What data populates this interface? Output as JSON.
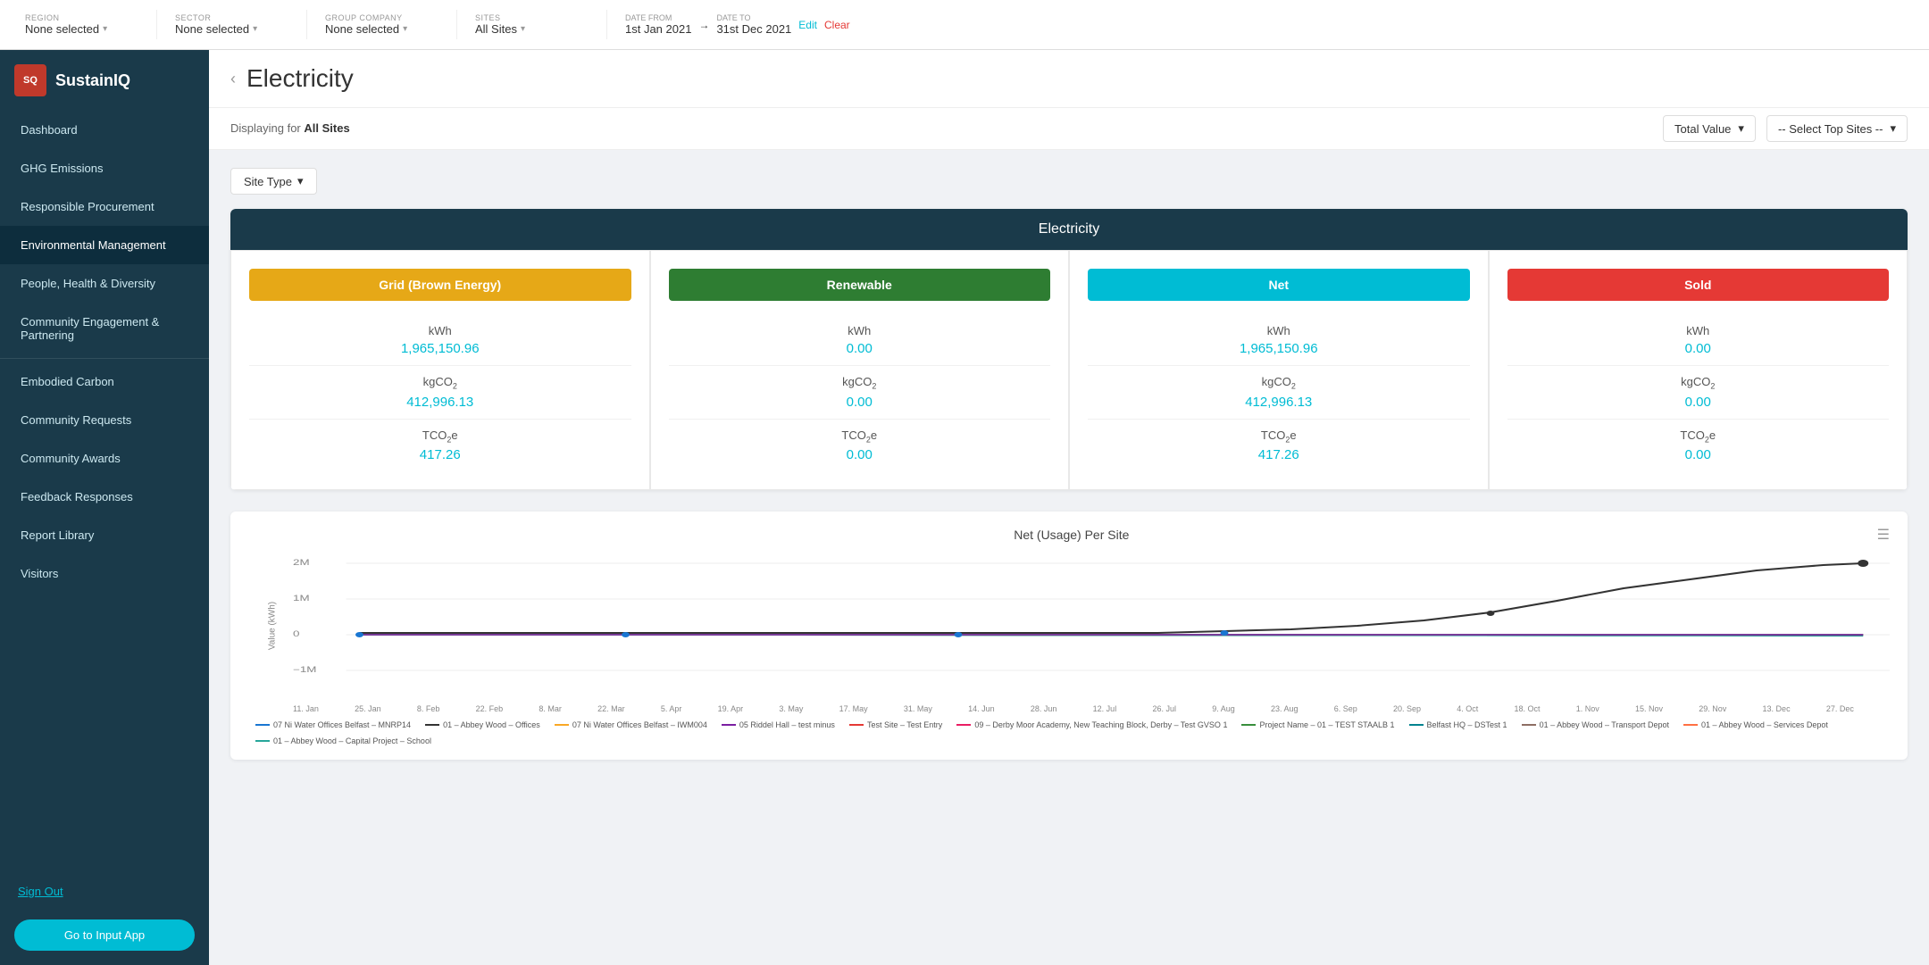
{
  "topbar": {
    "region_label": "REGION",
    "region_value": "None selected",
    "sector_label": "SECTOR",
    "sector_value": "None selected",
    "group_company_label": "GROUP COMPANY",
    "group_company_value": "None selected",
    "sites_label": "SITES",
    "sites_value": "All Sites",
    "date_from_label": "DATE FROM",
    "date_from_value": "1st Jan 2021",
    "date_to_label": "DATE TO",
    "date_to_value": "31st Dec 2021",
    "edit_label": "Edit",
    "clear_label": "Clear"
  },
  "sidebar": {
    "logo_text": "SQ",
    "app_name": "SustainIQ",
    "items": [
      {
        "id": "dashboard",
        "label": "Dashboard"
      },
      {
        "id": "ghg",
        "label": "GHG Emissions"
      },
      {
        "id": "procurement",
        "label": "Responsible Procurement"
      },
      {
        "id": "env-mgmt",
        "label": "Environmental Management"
      },
      {
        "id": "people",
        "label": "People, Health & Diversity"
      },
      {
        "id": "community",
        "label": "Community Engagement & Partnering"
      },
      {
        "id": "embodied",
        "label": "Embodied Carbon"
      },
      {
        "id": "requests",
        "label": "Community Requests"
      },
      {
        "id": "awards",
        "label": "Community Awards"
      },
      {
        "id": "feedback",
        "label": "Feedback Responses"
      },
      {
        "id": "report",
        "label": "Report Library"
      },
      {
        "id": "visitors",
        "label": "Visitors"
      }
    ],
    "sign_out": "Sign Out",
    "go_to_input": "Go to Input App"
  },
  "page": {
    "back": "‹",
    "title": "Electricity",
    "displaying_label": "Displaying for",
    "displaying_value": "All Sites"
  },
  "controls": {
    "total_value": "Total Value",
    "select_top_sites": "-- Select Top Sites --",
    "site_type": "Site Type"
  },
  "panel": {
    "title": "Electricity",
    "cards": [
      {
        "id": "brown",
        "label": "Grid (Brown Energy)",
        "color_class": "brown",
        "kwh_label": "kWh",
        "kwh_value": "1,965,150.96",
        "kgco2_label": "kgCO₂",
        "kgco2_value": "412,996.13",
        "tco2e_label": "TCO₂e",
        "tco2e_value": "417.26"
      },
      {
        "id": "renewable",
        "label": "Renewable",
        "color_class": "green",
        "kwh_label": "kWh",
        "kwh_value": "0.00",
        "kgco2_label": "kgCO₂",
        "kgco2_value": "0.00",
        "tco2e_label": "TCO₂e",
        "tco2e_value": "0.00"
      },
      {
        "id": "net",
        "label": "Net",
        "color_class": "cyan",
        "kwh_label": "kWh",
        "kwh_value": "1,965,150.96",
        "kgco2_label": "kgCO₂",
        "kgco2_value": "412,996.13",
        "tco2e_label": "TCO₂e",
        "tco2e_value": "417.26"
      },
      {
        "id": "sold",
        "label": "Sold",
        "color_class": "orange",
        "kwh_label": "kWh",
        "kwh_value": "0.00",
        "kgco2_label": "kgCO₂",
        "kgco2_value": "0.00",
        "tco2e_label": "TCO₂e",
        "tco2e_value": "0.00"
      }
    ]
  },
  "chart": {
    "title": "Net (Usage) Per Site",
    "y_label": "Value (kWh)",
    "x_labels": [
      "11. Jan",
      "25. Jan",
      "8. Feb",
      "22. Feb",
      "8. Mar",
      "22. Mar",
      "5. Apr",
      "19. Apr",
      "3. May",
      "17. May",
      "31. May",
      "14. Jun",
      "28. Jun",
      "12. Jul",
      "26. Jul",
      "9. Aug",
      "23. Aug",
      "6. Sep",
      "20. Sep",
      "4. Oct",
      "18. Oct",
      "1. Nov",
      "15. Nov",
      "29. Nov",
      "13. Dec",
      "27. Dec"
    ],
    "y_ticks": [
      "2M",
      "1M",
      "0",
      "−1M"
    ],
    "legend": [
      {
        "label": "07 Ni Water Offices Belfast – MNRP14",
        "color": "#1976d2"
      },
      {
        "label": "01 – Abbey Wood – Offices",
        "color": "#333"
      },
      {
        "label": "07 Ni Water Offices Belfast – IWM004",
        "color": "#f9a825"
      },
      {
        "label": "05 Riddel Hall – test minus",
        "color": "#7b1fa2"
      },
      {
        "label": "Test Site – Test Entry",
        "color": "#e53935"
      },
      {
        "label": "09 – Derby Moor Academy, New Teaching Block, Derby – Test GVSO 1",
        "color": "#e91e63"
      },
      {
        "label": "Project Name – 01 – TEST STAALB 1",
        "color": "#388e3c"
      },
      {
        "label": "Belfast HQ – DSTest 1",
        "color": "#00838f"
      },
      {
        "label": "01 – Abbey Wood – Transport Depot",
        "color": "#8d6e63"
      },
      {
        "label": "01 – Abbey Wood – Services Depot",
        "color": "#ff7043"
      },
      {
        "label": "01 – Abbey Wood – Capital Project – School",
        "color": "#26a69a"
      }
    ]
  }
}
